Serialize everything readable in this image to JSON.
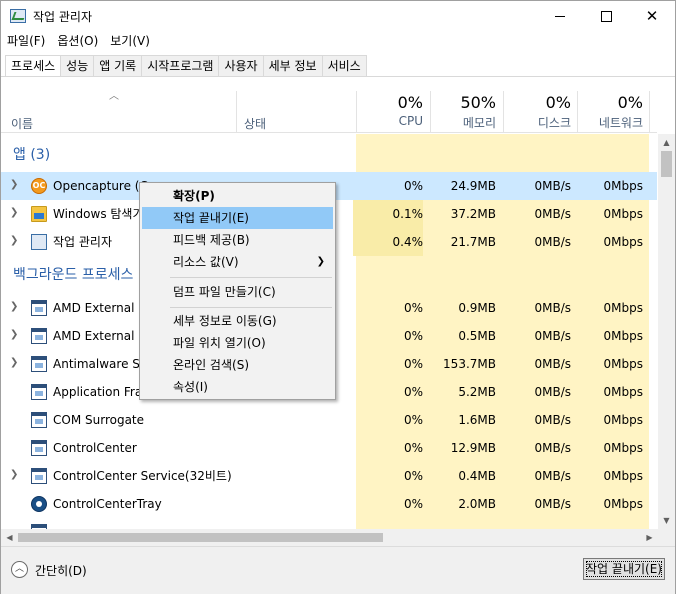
{
  "window": {
    "title": "작업 관리자"
  },
  "menu": [
    "파일(F)",
    "옵션(O)",
    "보기(V)"
  ],
  "tabs": [
    "프로세스",
    "성능",
    "앱 기록",
    "시작프로그램",
    "사용자",
    "세부 정보",
    "서비스"
  ],
  "columns": {
    "name": "이름",
    "status": "상태",
    "cpu": {
      "pct": "0%",
      "label": "CPU"
    },
    "memory": {
      "pct": "50%",
      "label": "메모리"
    },
    "disk": {
      "pct": "0%",
      "label": "디스크"
    },
    "network": {
      "pct": "0%",
      "label": "네트워크"
    }
  },
  "groups": {
    "apps": "앱 (3)",
    "background": "백그라운드 프로세스"
  },
  "rows": [
    {
      "name": "Opencapture (C",
      "cpu": "0%",
      "mem": "24.9MB",
      "disk": "0MB/s",
      "net": "0Mbps",
      "icon": "opencapture-icon"
    },
    {
      "name": "Windows 탐색기",
      "cpu": "0.1%",
      "mem": "37.2MB",
      "disk": "0MB/s",
      "net": "0Mbps",
      "icon": "folder-icon"
    },
    {
      "name": "작업 관리자",
      "cpu": "0.4%",
      "mem": "21.7MB",
      "disk": "0MB/s",
      "net": "0Mbps",
      "icon": "task-manager-icon"
    },
    {
      "name": "AMD External E",
      "cpu": "0%",
      "mem": "0.9MB",
      "disk": "0MB/s",
      "net": "0Mbps",
      "icon": "app-window-icon"
    },
    {
      "name": "AMD External E",
      "cpu": "0%",
      "mem": "0.5MB",
      "disk": "0MB/s",
      "net": "0Mbps",
      "icon": "app-window-icon"
    },
    {
      "name": "Antimalware Se",
      "cpu": "0%",
      "mem": "153.7MB",
      "disk": "0MB/s",
      "net": "0Mbps",
      "icon": "app-window-icon"
    },
    {
      "name": "Application Fra",
      "cpu": "0%",
      "mem": "5.2MB",
      "disk": "0MB/s",
      "net": "0Mbps",
      "icon": "app-window-icon"
    },
    {
      "name": "COM Surrogate",
      "cpu": "0%",
      "mem": "1.6MB",
      "disk": "0MB/s",
      "net": "0Mbps",
      "icon": "app-window-icon"
    },
    {
      "name": "ControlCenter",
      "cpu": "0%",
      "mem": "12.9MB",
      "disk": "0MB/s",
      "net": "0Mbps",
      "icon": "app-window-icon"
    },
    {
      "name": "ControlCenter Service(32비트)",
      "cpu": "0%",
      "mem": "0.4MB",
      "disk": "0MB/s",
      "net": "0Mbps",
      "icon": "app-window-icon"
    },
    {
      "name": "ControlCenterTray",
      "cpu": "0%",
      "mem": "2.0MB",
      "disk": "0MB/s",
      "net": "0Mbps",
      "icon": "control-center-tray-icon"
    }
  ],
  "context_menu": [
    "확장(P)",
    "작업 끝내기(E)",
    "피드백 제공(B)",
    "리소스 값(V)",
    "덤프 파일 만들기(C)",
    "세부 정보로 이동(G)",
    "파일 위치 열기(O)",
    "온라인 검색(S)",
    "속성(I)"
  ],
  "footer": {
    "fewer_details": "간단히(D)",
    "end_task": "작업 끝내기(E)"
  },
  "colors": {
    "selection": "#cce8ff",
    "highlight": "#fff4c4",
    "menu_highlight": "#91c9f7",
    "group_text": "#2a5fa8"
  }
}
